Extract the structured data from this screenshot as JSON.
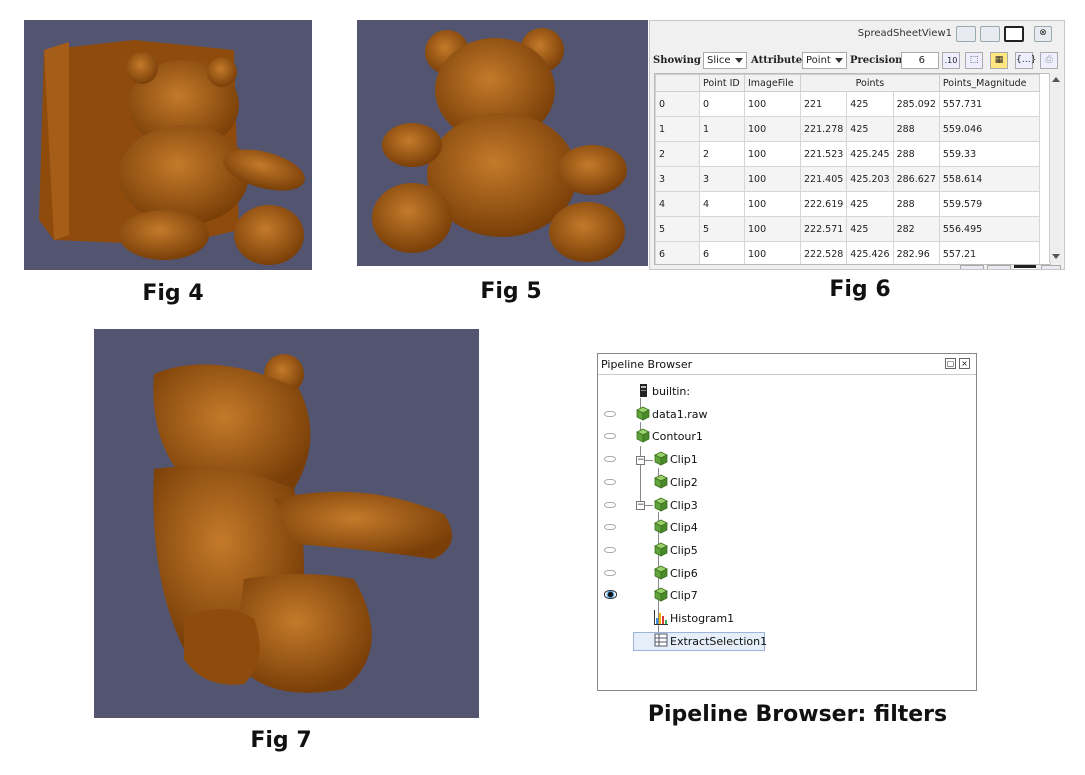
{
  "captions": {
    "fig4": "Fig 4",
    "fig5": "Fig 5",
    "fig6": "Fig 6",
    "fig7": "Fig 7",
    "pipeline": "Pipeline Browser: filters"
  },
  "colors": {
    "viewport_bg": "#525470",
    "bear": "#a85e14",
    "selection": "#e6eef9"
  },
  "spreadsheet": {
    "title": "SpreadSheetView1",
    "showing_label": "Showing",
    "showing_value": "Slice",
    "attribute_label": "Attribute",
    "attribute_value": "Point",
    "precision_label": "Precision",
    "precision_value": "6",
    "columns": [
      "",
      "Point ID",
      "ImageFile",
      "Points",
      "",
      "",
      "Points_Magnitude"
    ],
    "rows": [
      [
        "0",
        "0",
        "100",
        "221",
        "425",
        "285.092",
        "557.731"
      ],
      [
        "1",
        "1",
        "100",
        "221.278",
        "425",
        "288",
        "559.046"
      ],
      [
        "2",
        "2",
        "100",
        "221.523",
        "425.245",
        "288",
        "559.33"
      ],
      [
        "3",
        "3",
        "100",
        "221.405",
        "425.203",
        "286.627",
        "558.614"
      ],
      [
        "4",
        "4",
        "100",
        "222.619",
        "425",
        "288",
        "559.579"
      ],
      [
        "5",
        "5",
        "100",
        "222.571",
        "425",
        "282",
        "556.495"
      ],
      [
        "6",
        "6",
        "100",
        "222.528",
        "425.426",
        "282.96",
        "557.21"
      ]
    ]
  },
  "pipeline": {
    "title": "Pipeline Browser",
    "items": [
      {
        "label": "builtin:",
        "icon": "server-icon",
        "eye": "none"
      },
      {
        "label": "data1.raw",
        "icon": "cube-icon",
        "eye": "off"
      },
      {
        "label": "Contour1",
        "icon": "cube-icon",
        "eye": "off"
      },
      {
        "label": "Clip1",
        "icon": "cube-icon",
        "eye": "off"
      },
      {
        "label": "Clip2",
        "icon": "cube-icon",
        "eye": "off"
      },
      {
        "label": "Clip3",
        "icon": "cube-icon",
        "eye": "off"
      },
      {
        "label": "Clip4",
        "icon": "cube-icon",
        "eye": "off"
      },
      {
        "label": "Clip5",
        "icon": "cube-icon",
        "eye": "off"
      },
      {
        "label": "Clip6",
        "icon": "cube-icon",
        "eye": "off"
      },
      {
        "label": "Clip7",
        "icon": "cube-icon",
        "eye": "on"
      },
      {
        "label": "Histogram1",
        "icon": "histogram-icon",
        "eye": "none"
      },
      {
        "label": "ExtractSelection1",
        "icon": "spreadsheet-icon",
        "eye": "none",
        "selected": true
      }
    ]
  }
}
